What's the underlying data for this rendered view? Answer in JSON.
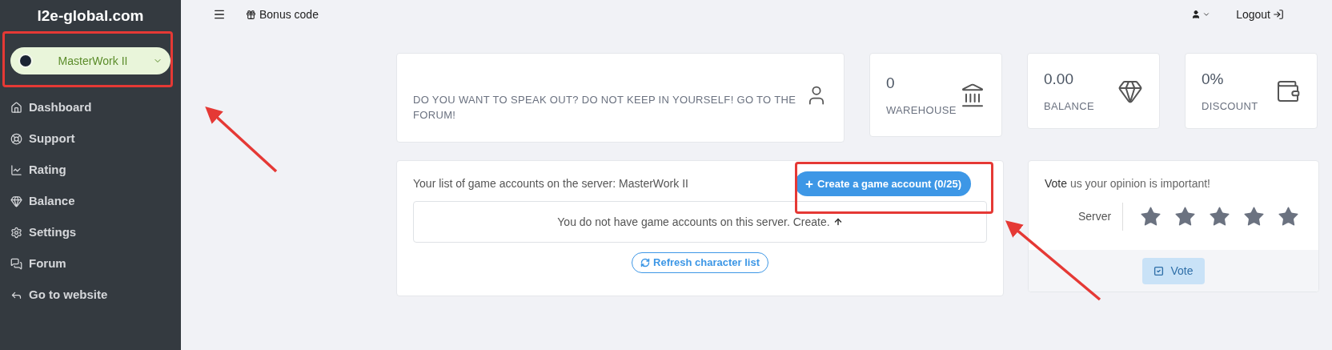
{
  "sidebar": {
    "brand": "l2e-global.com",
    "server_select": {
      "value": "MasterWork II"
    },
    "items": [
      {
        "label": "Dashboard"
      },
      {
        "label": "Support"
      },
      {
        "label": "Rating"
      },
      {
        "label": "Balance"
      },
      {
        "label": "Settings"
      },
      {
        "label": "Forum"
      },
      {
        "label": "Go to website"
      }
    ]
  },
  "topbar": {
    "bonus": "Bonus code",
    "logout": "Logout"
  },
  "forum_card": {
    "text": "DO YOU WANT TO SPEAK OUT? DO NOT KEEP IN YOURSELF! GO TO THE FORUM!"
  },
  "stats": [
    {
      "value": "0",
      "label": "WAREHOUSE"
    },
    {
      "value": "0.00",
      "label": "BALANCE"
    },
    {
      "value": "0%",
      "label": "DISCOUNT"
    }
  ],
  "accounts": {
    "title": "Your list of game accounts on the server: MasterWork II",
    "create_button": "Create a game account (0/25)",
    "empty_text": "You do not have game accounts on this server. Create.",
    "refresh_button": "Refresh character list"
  },
  "vote": {
    "title": "**Vote** us your opinion is important!",
    "server_label": "Server",
    "stars": 5,
    "button": "Vote"
  }
}
